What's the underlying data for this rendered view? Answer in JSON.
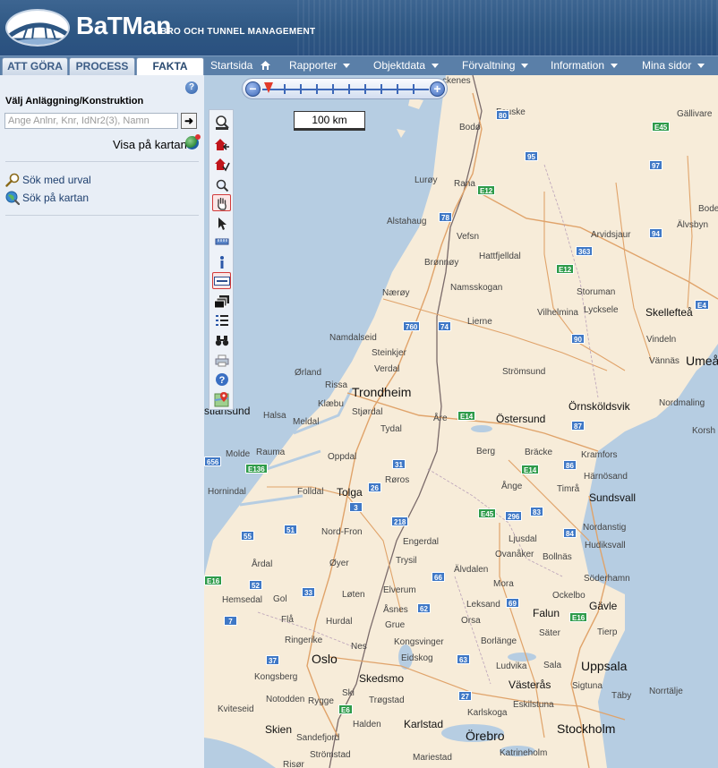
{
  "header": {
    "brand": "BaTMan",
    "subtitle": "BRO OCH TUNNEL MANAGEMENT"
  },
  "tabs": [
    {
      "label": "ATT GÖRA",
      "active": false
    },
    {
      "label": "PROCESS",
      "active": false
    },
    {
      "label": "FAKTA",
      "active": true
    }
  ],
  "nav": {
    "startsida": "Startsida",
    "rapporter": "Rapporter",
    "objektdata": "Objektdata",
    "forvaltning": "Förvaltning",
    "information": "Information",
    "mina_sidor": "Mina sidor"
  },
  "left": {
    "help": "?",
    "title": "Välj Anläggning/Konstruktion",
    "search_placeholder": "Ange Anlnr, Knr, IdNr2(3), Namn",
    "search_value": "",
    "go": "➜",
    "show_on_map": "Visa på kartan",
    "link_filter": "Sök med urval",
    "link_map": "Sök på kartan"
  },
  "map": {
    "scale": "100 km",
    "labels": {
      "l01": "ckenes",
      "l02": "Fauske",
      "l03": "Gällivare",
      "l04": "Bodø",
      "l05": "Bode",
      "l06": "Rana",
      "l07": "Lurøy",
      "l08": "Alstahaug",
      "l09": "Vefsn",
      "l10": "Arvidsjaur",
      "l11": "Älvsbyn",
      "l12": "Hattfjelldal",
      "l13": "Brønnøy",
      "l14": "Nærøy",
      "l15": "Namsskogan",
      "l16": "Storuman",
      "l17": "Vilhelmina",
      "l18": "Lycksele",
      "l19": "Skellefteå",
      "l20": "Lierne",
      "l21": "Vindeln",
      "l22": "Namdalseid",
      "l23": "Steinkjer",
      "l24": "Verdal",
      "l25": "Vännäs",
      "l26": "Umeå",
      "l27": "Ørland",
      "l28": "Rissa",
      "l29": "Strömsund",
      "l30": "Trondheim",
      "l31": "Örnsköldsvik",
      "l32": "stiansund",
      "l33": "Klæbu",
      "l34": "Stjørdal",
      "l35": "Halsa",
      "l36": "Meldal",
      "l37": "Tydal",
      "l38": "Åre",
      "l39": "Östersund",
      "l40": "Nordmaling",
      "l41": "Korsh",
      "l42": "Molde",
      "l43": "Rauma",
      "l44": "Berg",
      "l45": "Bräcke",
      "l46": "Kramfors",
      "l47": "Oppdal",
      "l48": "Røros",
      "l49": "Härnösand",
      "l50": "Hornindal",
      "l51": "Folldal",
      "l52": "Tolga",
      "l53": "Ånge",
      "l54": "Timrå",
      "l55": "Sundsvall",
      "l56": "Nord-Fron",
      "l57": "Ljusdal",
      "l58": "Nordanstig",
      "l59": "Hudiksvall",
      "l60": "Engerdal",
      "l61": "Ovanåker",
      "l62": "Bollnäs",
      "l63": "Årdal",
      "l64": "Øyer",
      "l65": "Trysil",
      "l66": "Älvdalen",
      "l67": "Söderhamn",
      "l68": "Hemsedal",
      "l69": "Gol",
      "l70": "Løten",
      "l71": "Elverum",
      "l72": "Mora",
      "l73": "Ockelbo",
      "l74": "Leksand",
      "l75": "Falun",
      "l76": "Gävle",
      "l77": "Flå",
      "l78": "Hurdal",
      "l79": "Åsnes",
      "l80": "Grue",
      "l81": "Orsa",
      "l82": "Säter",
      "l83": "Tierp",
      "l84": "Ringerike",
      "l85": "Nes",
      "l86": "Kongsvinger",
      "l87": "Borlänge",
      "l88": "Oslo",
      "l89": "Eidskog",
      "l90": "Ludvika",
      "l91": "Sala",
      "l92": "Uppsala",
      "l93": "Kongsberg",
      "l94": "Skedsmo",
      "l95": "Västerås",
      "l96": "Sigtuna",
      "l97": "Norrtälje",
      "l98": "Ski",
      "l99": "Trøgstad",
      "l100": "Karlstad",
      "l101": "Täby",
      "l102": "Notodden",
      "l103": "Rygge",
      "l104": "Kviteseid",
      "l105": "Halden",
      "l106": "Karlskoga",
      "l107": "Eskilstuna",
      "l108": "Skien",
      "l109": "Sandefjord",
      "l110": "Örebro",
      "l111": "Stockholm",
      "l112": "Strömstad",
      "l113": "Mariestad",
      "l114": "Katrineholm",
      "l115": "Risør"
    },
    "shields": {
      "s01": "80",
      "s02": "E45",
      "s03": "95",
      "s04": "97",
      "s05": "E12",
      "s06": "78",
      "s07": "94",
      "s08": "363",
      "s09": "E12",
      "s10": "E4",
      "s11": "760",
      "s12": "74",
      "s13": "90",
      "s14": "E14",
      "s15": "87",
      "s16": "E136",
      "s17": "26",
      "s18": "31",
      "s19": "E14",
      "s20": "86",
      "s21": "656",
      "s22": "3",
      "s23": "E45",
      "s24": "296",
      "s25": "83",
      "s26": "218",
      "s27": "55",
      "s28": "51",
      "s29": "84",
      "s30": "E16",
      "s31": "52",
      "s32": "33",
      "s33": "66",
      "s34": "62",
      "s35": "69",
      "s36": "E16",
      "s37": "7",
      "s38": "37",
      "s39": "63",
      "s40": "E6",
      "s41": "27"
    }
  }
}
